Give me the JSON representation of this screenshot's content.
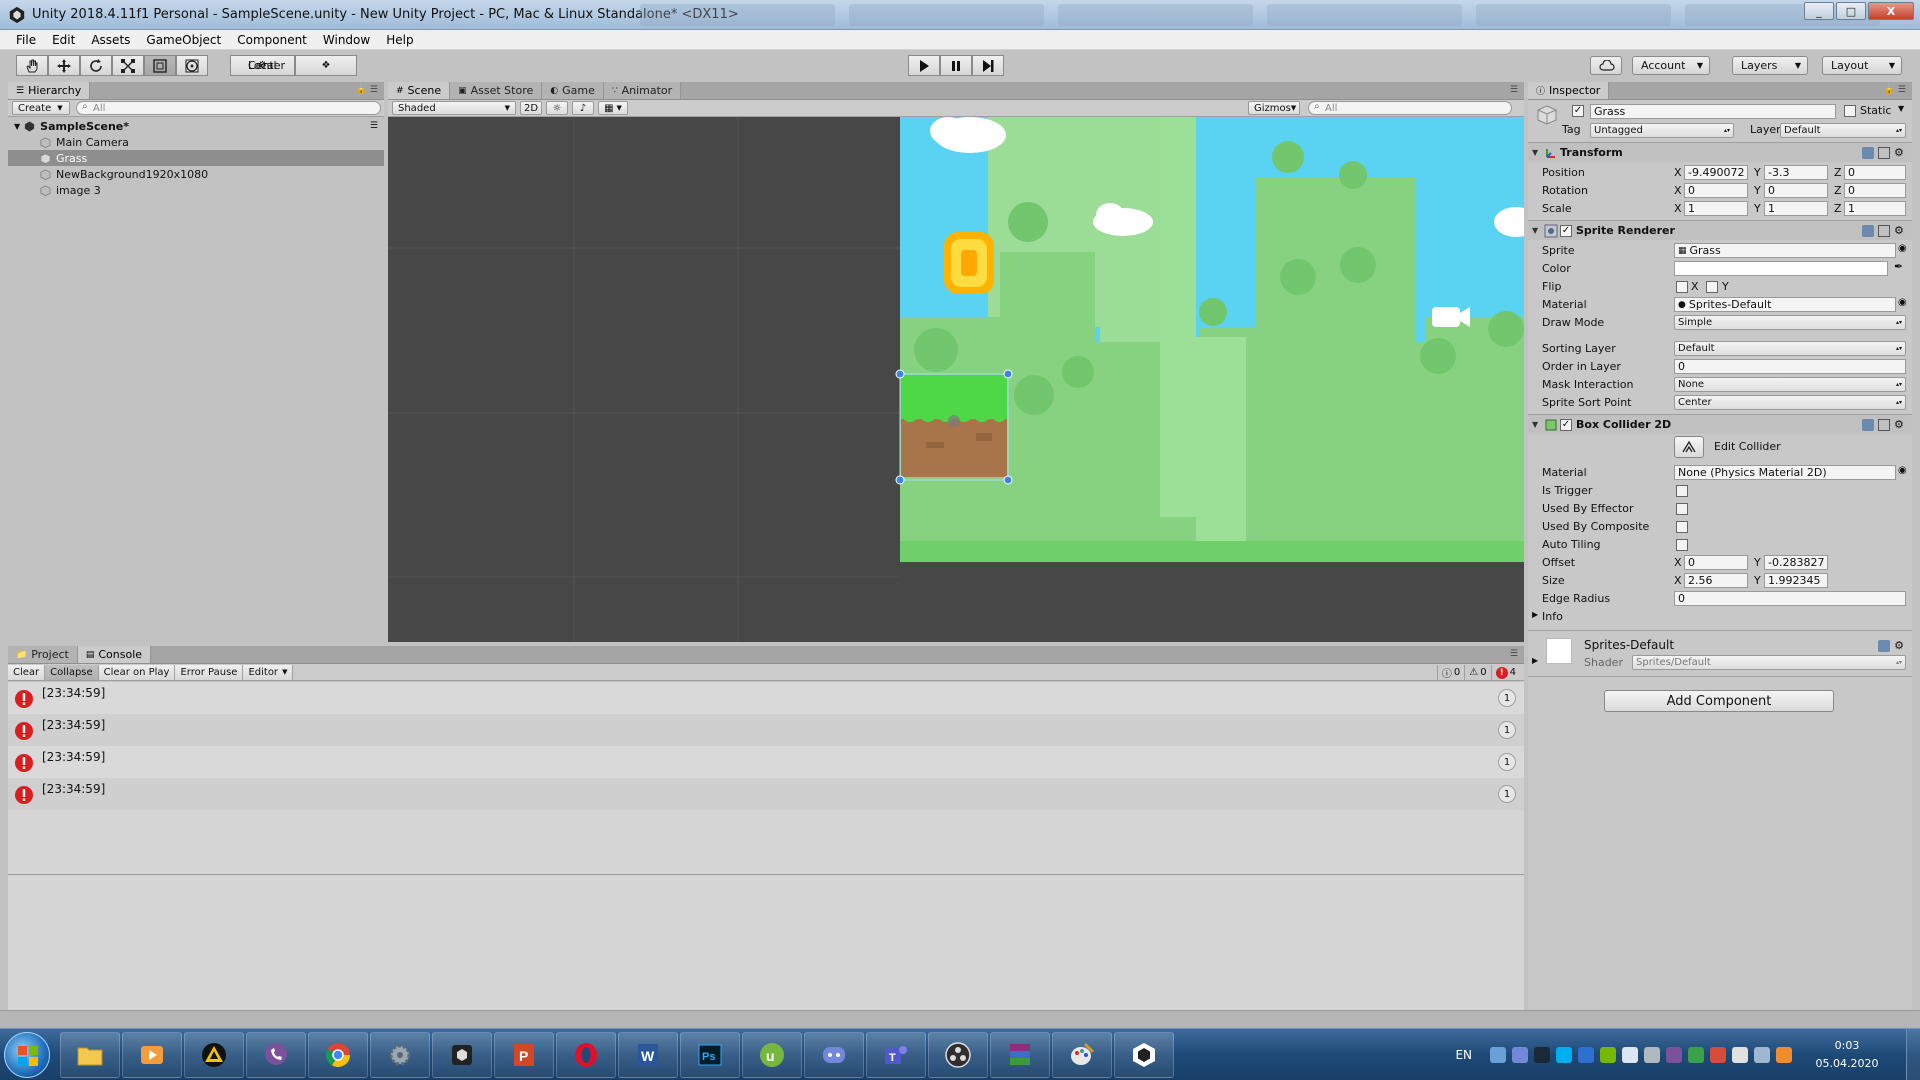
{
  "window": {
    "title": "Unity 2018.4.11f1 Personal - SampleScene.unity - New Unity Project - PC, Mac & Linux Standalone* <DX11>",
    "controls": [
      "_",
      "□",
      "X"
    ]
  },
  "menu": [
    "File",
    "Edit",
    "Assets",
    "GameObject",
    "Component",
    "Window",
    "Help"
  ],
  "toolbar": {
    "pivot": "Center",
    "space": "Local",
    "account": "Account",
    "layers": "Layers",
    "layout": "Layout"
  },
  "hierarchy": {
    "tab": "Hierarchy",
    "create": "Create",
    "search_placeholder": "All",
    "scene": "SampleScene*",
    "items": [
      "Main Camera",
      "Grass",
      "NewBackground1920x1080",
      "image 3"
    ],
    "selected_index": 1
  },
  "scene_view": {
    "tabs": [
      "Scene",
      "Asset Store",
      "Game",
      "Animator"
    ],
    "active_tab": 0,
    "shading": "Shaded",
    "mode_2d": "2D",
    "gizmos": "Gizmos",
    "search_placeholder": "All"
  },
  "console": {
    "tabs": [
      "Project",
      "Console"
    ],
    "active_tab": 1,
    "buttons": [
      "Clear",
      "Collapse",
      "Clear on Play",
      "Error Pause",
      "Editor"
    ],
    "counts": {
      "info": "0",
      "warn": "0",
      "error": "4"
    },
    "rows": [
      {
        "time": "[23:34:59]",
        "count": "1"
      },
      {
        "time": "[23:34:59]",
        "count": "1"
      },
      {
        "time": "[23:34:59]",
        "count": "1"
      },
      {
        "time": "[23:34:59]",
        "count": "1"
      }
    ]
  },
  "inspector": {
    "tab": "Inspector",
    "object_name": "Grass",
    "static": "Static",
    "tag_label": "Tag",
    "tag": "Untagged",
    "layer_label": "Layer",
    "layer": "Default",
    "transform": {
      "title": "Transform",
      "position_label": "Position",
      "rotation_label": "Rotation",
      "scale_label": "Scale",
      "position": {
        "x": "-9.490072",
        "y": "-3.3",
        "z": "0"
      },
      "rotation": {
        "x": "0",
        "y": "0",
        "z": "0"
      },
      "scale": {
        "x": "1",
        "y": "1",
        "z": "1"
      }
    },
    "sprite_renderer": {
      "title": "Sprite Renderer",
      "sprite_label": "Sprite",
      "sprite": "Grass",
      "color_label": "Color",
      "flip_label": "Flip",
      "flip_x": "X",
      "flip_y": "Y",
      "material_label": "Material",
      "material": "Sprites-Default",
      "draw_mode_label": "Draw Mode",
      "draw_mode": "Simple",
      "sorting_layer_label": "Sorting Layer",
      "sorting_layer": "Default",
      "order_label": "Order in Layer",
      "order": "0",
      "mask_label": "Mask Interaction",
      "mask": "None",
      "sort_point_label": "Sprite Sort Point",
      "sort_point": "Center"
    },
    "box_collider": {
      "title": "Box Collider 2D",
      "edit_collider": "Edit Collider",
      "material_label": "Material",
      "material": "None (Physics Material 2D)",
      "is_trigger": "Is Trigger",
      "used_by_effector": "Used By Effector",
      "used_by_composite": "Used By Composite",
      "auto_tiling": "Auto Tiling",
      "offset_label": "Offset",
      "offset": {
        "x": "0",
        "y": "-0.283827"
      },
      "size_label": "Size",
      "size": {
        "x": "2.56",
        "y": "1.992345"
      },
      "edge_radius_label": "Edge Radius",
      "edge_radius": "0",
      "info": "Info"
    },
    "material_preview": {
      "name": "Sprites-Default",
      "shader_label": "Shader",
      "shader": "Sprites/Default"
    },
    "add_component": "Add Component"
  },
  "taskbar": {
    "language": "EN",
    "time": "0:03",
    "date": "05.04.2020",
    "apps": [
      "explorer",
      "media-player",
      "vlc-like",
      "viber",
      "chrome",
      "settings",
      "unity-hub",
      "powerpoint",
      "opera",
      "word",
      "photoshop",
      "utorrent",
      "discord",
      "teams",
      "obs",
      "winrar",
      "paint",
      "unity"
    ]
  },
  "colors": {
    "sky": "#5ad2f2",
    "grass": "#4fd845",
    "dirt": "#a8744a",
    "bg_green": "#93d98e",
    "error": "#d81e1e"
  }
}
